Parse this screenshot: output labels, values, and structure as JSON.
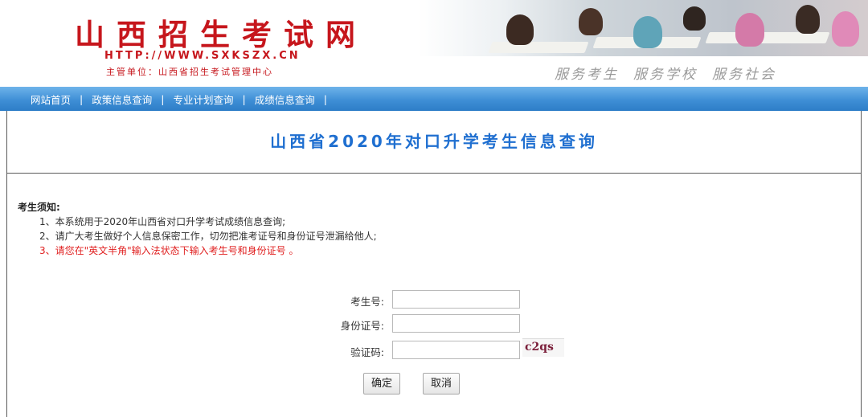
{
  "header": {
    "site_title": "山西招生考试网",
    "site_url": "HTTP://WWW.SXKSZX.CN",
    "organizer": "主管单位：山西省招生考试管理中心",
    "slogans": [
      "服务考生",
      "服务学校",
      "服务社会"
    ]
  },
  "nav": {
    "items": [
      "网站首页",
      "政策信息查询",
      "专业计划查询",
      "成绩信息查询"
    ],
    "separator": "|"
  },
  "page": {
    "title": "山西省2020年对口升学考生信息查询"
  },
  "notice": {
    "title": "考生须知:",
    "items": [
      "1、本系统用于2020年山西省对口升学考试成绩信息查询;",
      "2、请广大考生做好个人信息保密工作，切勿把准考证号和身份证号泄漏给他人;",
      "3、请您在\"英文半角\"输入法状态下输入考生号和身份证号 。"
    ]
  },
  "form": {
    "exam_no_label": "考生号:",
    "exam_no_value": "",
    "id_no_label": "身份证号:",
    "id_no_value": "",
    "captcha_label": "验证码:",
    "captcha_value": "",
    "captcha_text": "c2qs",
    "submit_label": "确定",
    "cancel_label": "取消"
  },
  "colors": {
    "brand_red": "#c6161c",
    "nav_blue": "#3f8fd6",
    "title_blue": "#1f6fd0",
    "warning_red": "#e02020"
  }
}
